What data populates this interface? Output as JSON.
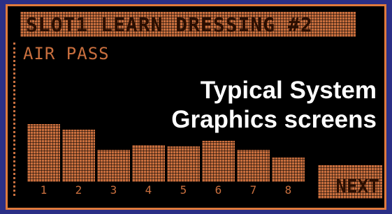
{
  "screen": {
    "title": "SLOT1 LEARN DRESSING #2",
    "subtitle": "AIR PASS",
    "next_label": "NEXT"
  },
  "overlay": {
    "line1": "Typical System",
    "line2": "Graphics screens"
  },
  "colors": {
    "background": "#2b2f86",
    "screen_bg": "#000000",
    "amber": "#c96f3e",
    "frame": "#e07a3c",
    "overlay_text": "#ffffff"
  },
  "chart_data": {
    "type": "bar",
    "categories": [
      "1",
      "2",
      "3",
      "4",
      "5",
      "6",
      "7",
      "8"
    ],
    "values": [
      0.9,
      0.82,
      0.5,
      0.58,
      0.55,
      0.64,
      0.5,
      0.38
    ],
    "ylim": [
      0,
      1
    ]
  }
}
